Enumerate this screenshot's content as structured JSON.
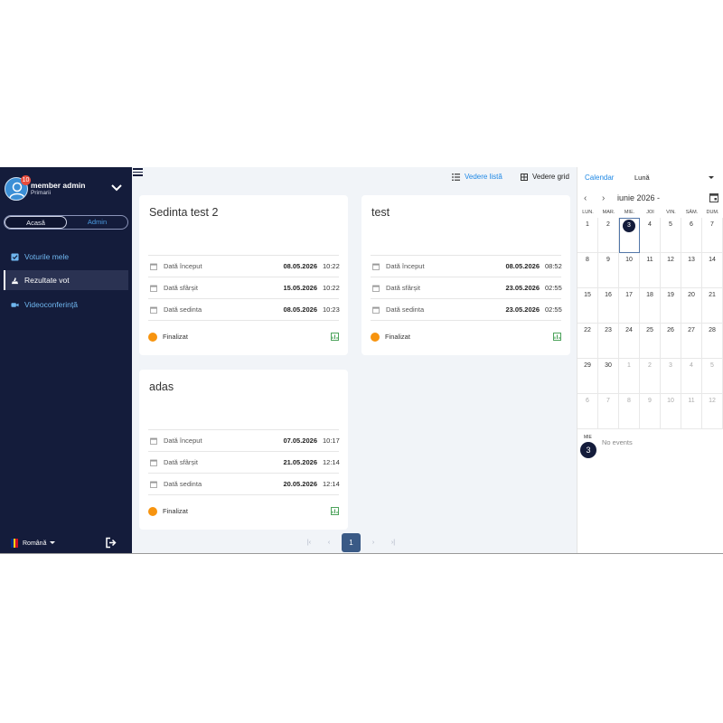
{
  "user": {
    "name": "member admin",
    "role": "Primarii",
    "notification_count": "10"
  },
  "toggle": {
    "left": "Acasă",
    "right": "Admin"
  },
  "nav": [
    {
      "label": "Voturile mele",
      "icon": "checkbox-icon"
    },
    {
      "label": "Rezultate vot",
      "icon": "vote-icon"
    },
    {
      "label": "Videoconferință",
      "icon": "video-icon"
    }
  ],
  "language": "Română",
  "toolbar": {
    "list_view": "Vedere listă",
    "grid_view": "Vedere grid"
  },
  "labels": {
    "start": "Dată început",
    "end": "Dată sfârșit",
    "session": "Dată sedinta",
    "status": "Finalizat"
  },
  "cards": [
    {
      "title": "Sedinta test 2",
      "start_date": "08.05.2026",
      "start_time": "10:22",
      "end_date": "15.05.2026",
      "end_time": "10:22",
      "session_date": "08.05.2026",
      "session_time": "10:23"
    },
    {
      "title": "test",
      "start_date": "08.05.2026",
      "start_time": "08:52",
      "end_date": "23.05.2026",
      "end_time": "02:55",
      "session_date": "23.05.2026",
      "session_time": "02:55"
    },
    {
      "title": "adas",
      "start_date": "07.05.2026",
      "start_time": "10:17",
      "end_date": "21.05.2026",
      "end_time": "12:14",
      "session_date": "20.05.2026",
      "session_time": "12:14"
    }
  ],
  "pagination": {
    "current": "1",
    "first": "|‹",
    "prev": "‹",
    "next": "›",
    "last": "›|"
  },
  "calendar": {
    "tab": "Calendar",
    "view": "Lună",
    "month": "iunie 2026 -",
    "prev": "‹",
    "next": "›",
    "weekdays": [
      "LUN.",
      "MAR.",
      "MIE.",
      "JOI",
      "VIN.",
      "SÂM.",
      "DUM."
    ],
    "weeks": [
      [
        "1",
        "2",
        "3",
        "4",
        "5",
        "6",
        "7"
      ],
      [
        "8",
        "9",
        "10",
        "11",
        "12",
        "13",
        "14"
      ],
      [
        "15",
        "16",
        "17",
        "18",
        "19",
        "20",
        "21"
      ],
      [
        "22",
        "23",
        "24",
        "25",
        "26",
        "27",
        "28"
      ],
      [
        "29",
        "30",
        "1",
        "2",
        "3",
        "4",
        "5"
      ],
      [
        "6",
        "7",
        "8",
        "9",
        "10",
        "11",
        "12"
      ]
    ],
    "agenda_weekday": "MIE",
    "agenda_day": "3",
    "no_events": "No events"
  },
  "colors": {
    "sidebar": "#141c3b",
    "accent": "#1e88e5",
    "status": "#f7940f",
    "page_active": "#3a5a86"
  }
}
